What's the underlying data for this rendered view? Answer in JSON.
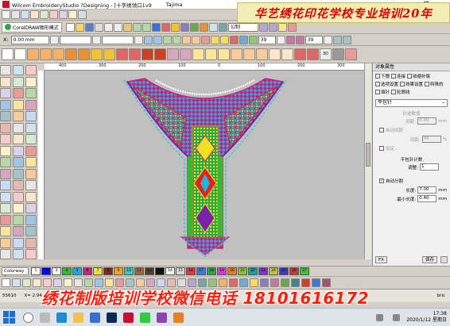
{
  "window": {
    "title": "Wilcom EmbroideryStudio ?Designing - [十字绣领口1v9",
    "machine": "Tajima",
    "min": "—",
    "max": "❐",
    "close": "✕"
  },
  "banner": "华艺绣花印花学校专业培训20年",
  "overlay_bottom": "绣花制版培训学校微信电话 18101616172",
  "toolbar": {
    "coreldraw": "CorelDRAW图形模式",
    "x_label": "X:",
    "x_value": "0.00 mm",
    "y_label": "Y:",
    "y_value": "0.00 mm",
    "font": "公制",
    "size1": "39",
    "size2": "39",
    "three_d": "3D"
  },
  "ruler_ticks": [
    "400",
    "300",
    "200",
    "100",
    "0",
    "100",
    "200",
    "300"
  ],
  "panel": {
    "title": "对象属性",
    "tabs": [
      {
        "label": "下摆",
        "icon": "hem-icon"
      },
      {
        "label": "连接",
        "icon": "connect-icon"
      },
      {
        "label": "收缩补偿",
        "icon": "shrink-icon"
      },
      {
        "label": "选项设置",
        "icon": "options-icon"
      },
      {
        "label": "效果设置",
        "icon": "effects-icon"
      },
      {
        "label": "特殊的",
        "icon": "special-icon"
      },
      {
        "label": "填针",
        "icon": "fill-icon"
      },
      {
        "label": "轮廓线",
        "icon": "outline-icon"
      }
    ],
    "stitch_type": "平包针",
    "sec_spacing": "针迹数值",
    "spacing_label": "间距:",
    "spacing_value": "0.40",
    "spacing_unit": "mm",
    "auto_spacing": "自动间距",
    "percent_label": "间距:",
    "percent_value": "90",
    "percent_unit": "%",
    "short_label": "设定...",
    "sec_count": "平包针计数",
    "count_label": "调整:",
    "count_value": "1",
    "auto_split": "自动分割",
    "len_label": "长度:",
    "len_value": "7.00",
    "len_unit": "mm",
    "min_len_label": "最小长度:",
    "min_len_value": "0.40",
    "min_len_unit": "mm",
    "fx": "FX",
    "save": "保存"
  },
  "colorbar": {
    "colorway": "Colorway 1",
    "chips": [
      {
        "n": "1",
        "c": "#ffffff"
      },
      {
        "n": "2",
        "c": "#0000ff"
      },
      {
        "n": "3",
        "c": "#f7f7f7"
      },
      {
        "n": "4",
        "c": "#35b833"
      },
      {
        "n": "5",
        "c": "#1fa9d6"
      },
      {
        "n": "6",
        "c": "#c0287a"
      },
      {
        "n": "7",
        "c": "#e8e23a"
      },
      {
        "n": "8",
        "c": "#7f2a1a"
      },
      {
        "n": "9",
        "c": "#f2a31c"
      },
      {
        "n": "10",
        "c": "#3cc6c2"
      },
      {
        "n": "11",
        "c": "#9b6b3c"
      },
      {
        "n": "12",
        "c": "#5a3c2a"
      },
      {
        "n": "13",
        "c": "#111111"
      },
      {
        "n": "14",
        "c": "#f5f5f5"
      },
      {
        "n": "15",
        "c": "#d9d9d9"
      },
      {
        "n": "16",
        "c": "#e03a3a"
      },
      {
        "n": "17",
        "c": "#3a7de0"
      },
      {
        "n": "18",
        "c": "#2aa64a"
      },
      {
        "n": "19",
        "c": "#d63ad6"
      },
      {
        "n": "20",
        "c": "#f07a1a"
      },
      {
        "n": "21",
        "c": "#88c43a"
      },
      {
        "n": "22",
        "c": "#18a0a0"
      },
      {
        "n": "23",
        "c": "#7a3ac4"
      },
      {
        "n": "24",
        "c": "#c4c43a"
      },
      {
        "n": "25",
        "c": "#3a3ac4"
      },
      {
        "n": "26",
        "c": "#c43a3a"
      },
      {
        "n": "27",
        "c": "#3ac43a"
      }
    ]
  },
  "status": {
    "stitches": "55610",
    "x": "X= 2.94 ...",
    "fabric": "bric"
  },
  "taskbar": {
    "time": "17:38",
    "date": "2020/1/12 星期日"
  }
}
